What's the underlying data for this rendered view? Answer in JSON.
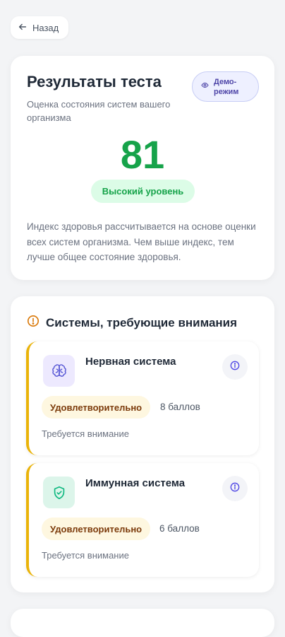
{
  "back": {
    "label": "Назад"
  },
  "results": {
    "title": "Результаты теста",
    "subtitle": "Оценка состояния систем вашего организма",
    "demo_badge": "Демо-режим",
    "score": "81",
    "level": "Высокий уровень",
    "description": "Индекс здоровья рассчитывается на основе оценки всех систем организма. Чем выше индекс, тем лучше общее состояние здоровья."
  },
  "systems": {
    "title": "Системы, требующие внимания",
    "items": [
      {
        "name": "Нервная система",
        "icon": "brain-icon",
        "status": "Удовлетворительно",
        "score": "8 баллов",
        "note": "Требуется внимание"
      },
      {
        "name": "Иммунная система",
        "icon": "shield-check-icon",
        "status": "Удовлетворительно",
        "score": "6 баллов",
        "note": "Требуется внимание"
      }
    ]
  },
  "colors": {
    "accent_green": "#16a34a",
    "warning_yellow": "#eab308",
    "demo_purple": "#4f46a8"
  }
}
